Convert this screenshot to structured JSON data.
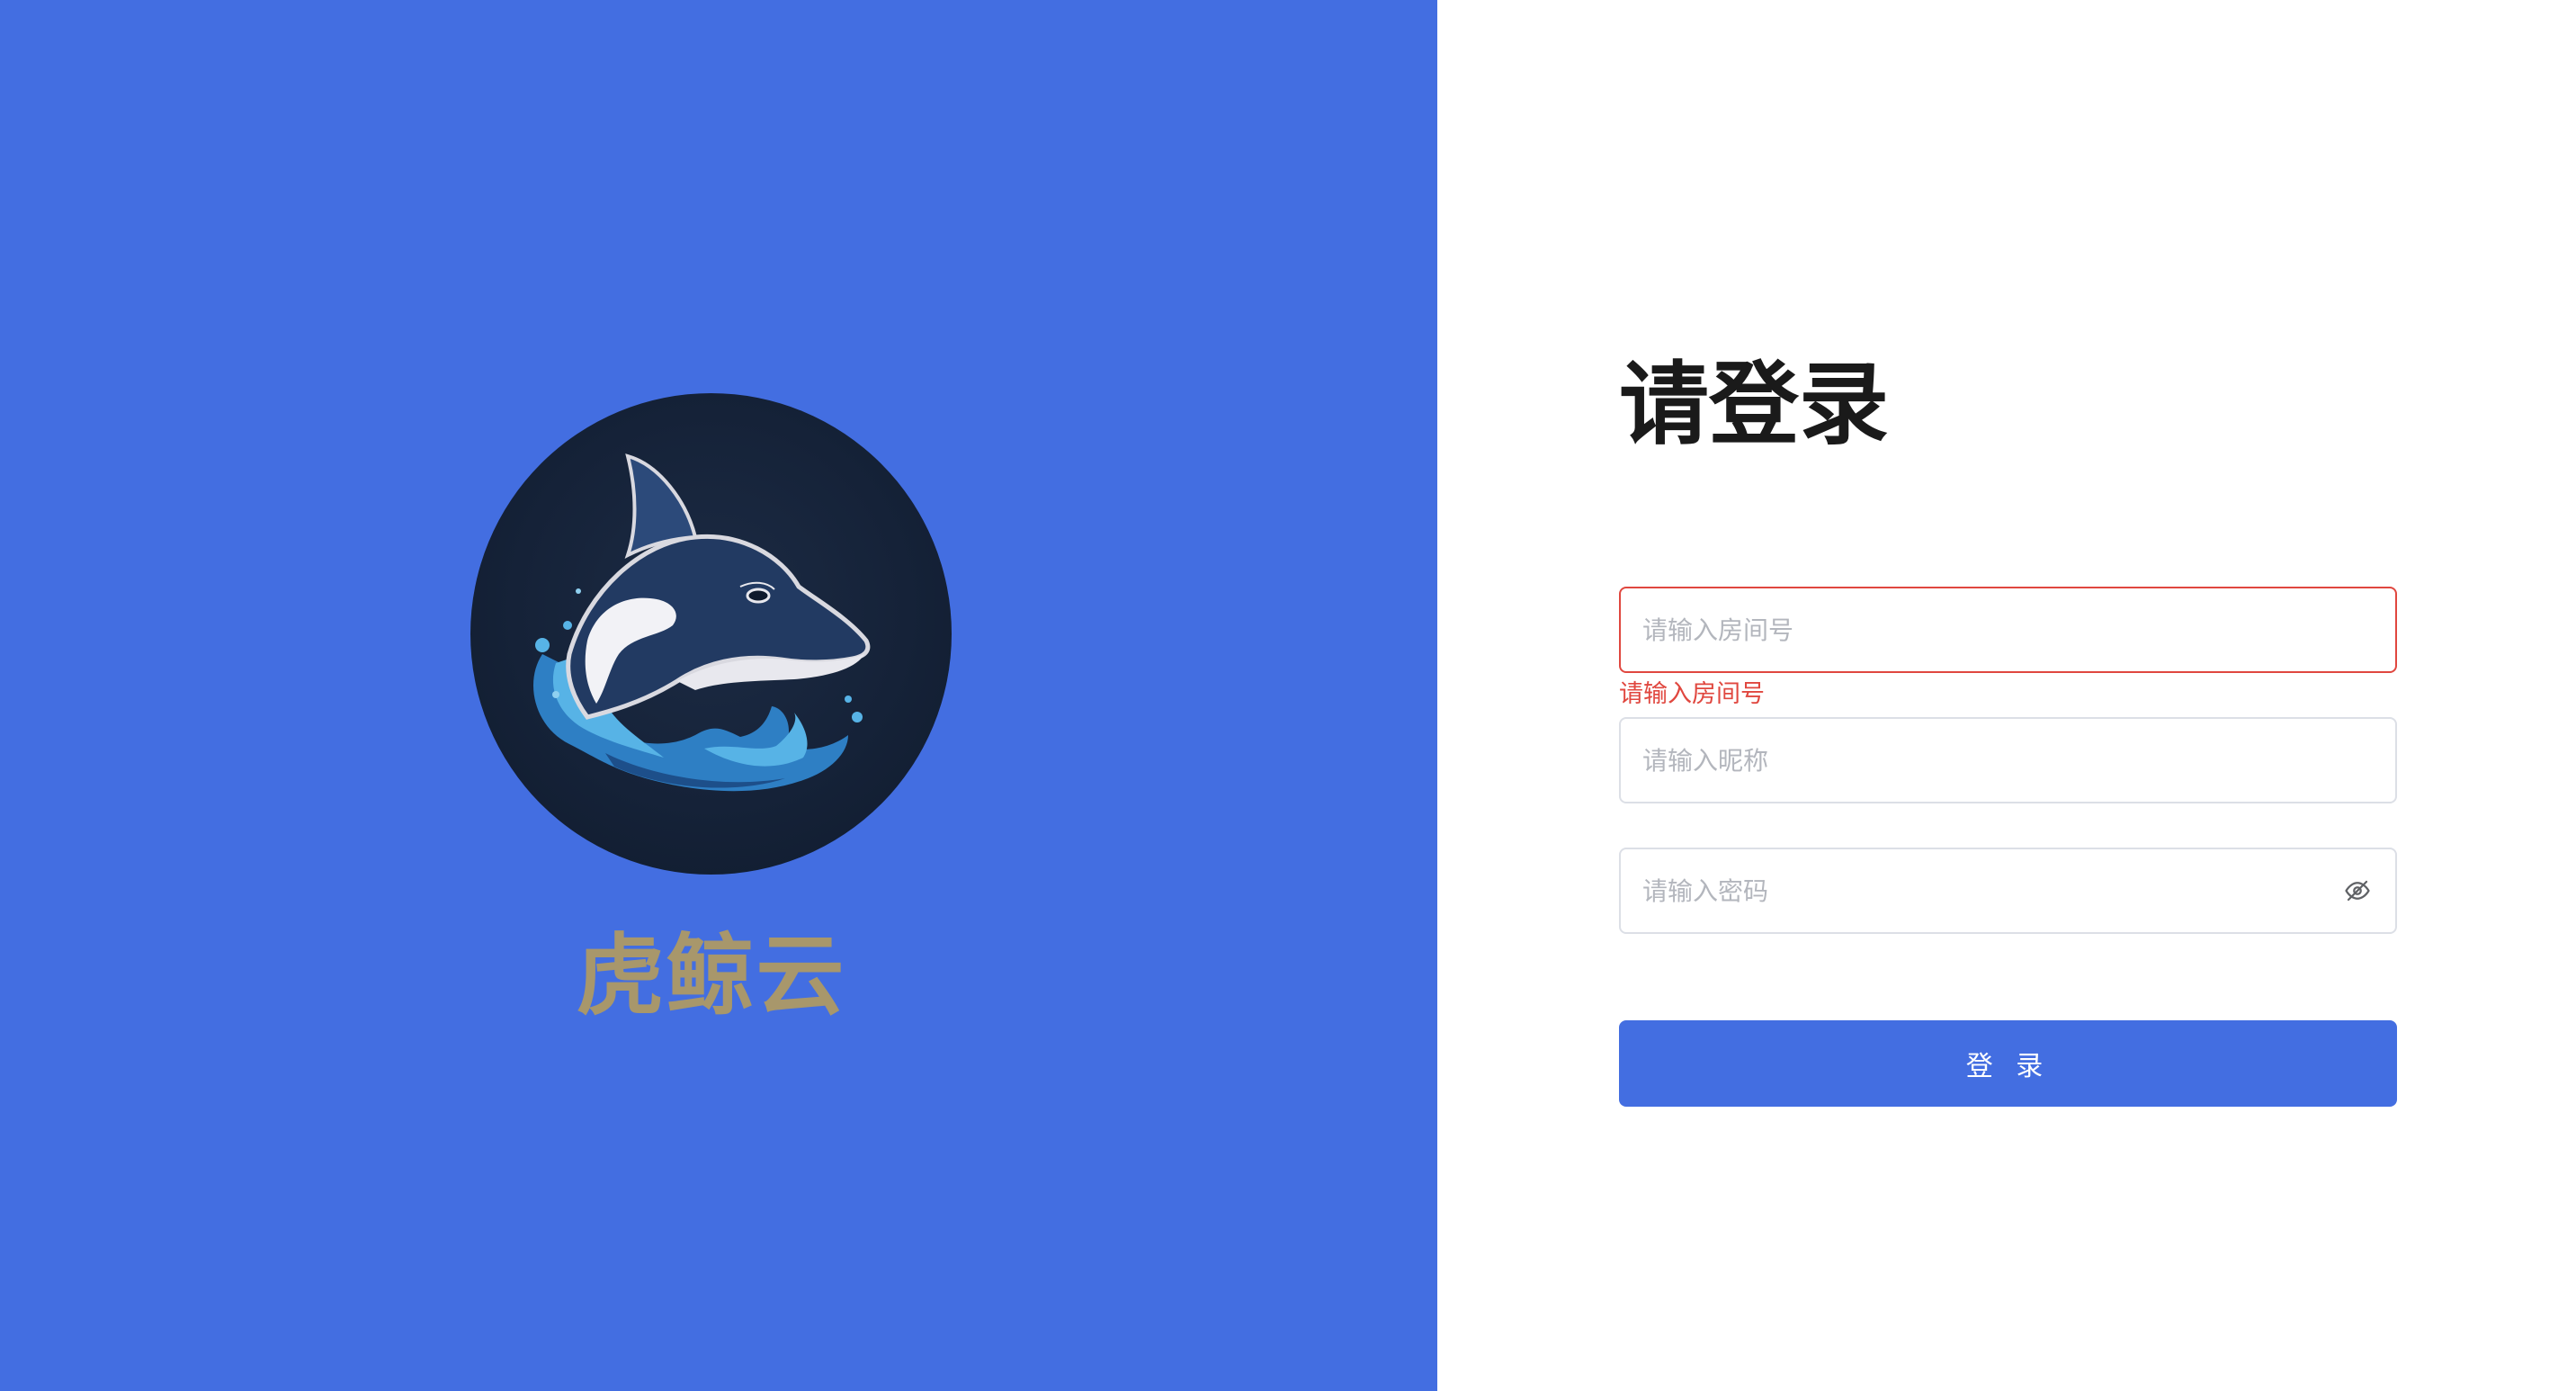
{
  "brand": {
    "name": "虎鲸云",
    "logo_icon": "orca-logo-icon"
  },
  "login": {
    "title": "请登录",
    "room_input": {
      "placeholder": "请输入房间号",
      "value": "",
      "error": "请输入房间号"
    },
    "nickname_input": {
      "placeholder": "请输入昵称",
      "value": ""
    },
    "password_input": {
      "placeholder": "请输入密码",
      "value": "",
      "toggle_icon": "eye-off-icon"
    },
    "submit_label": "登 录"
  },
  "colors": {
    "primary": "#436ee1",
    "brand_text": "#a8976b",
    "error": "#e0473f",
    "border": "#dcdfe6"
  }
}
